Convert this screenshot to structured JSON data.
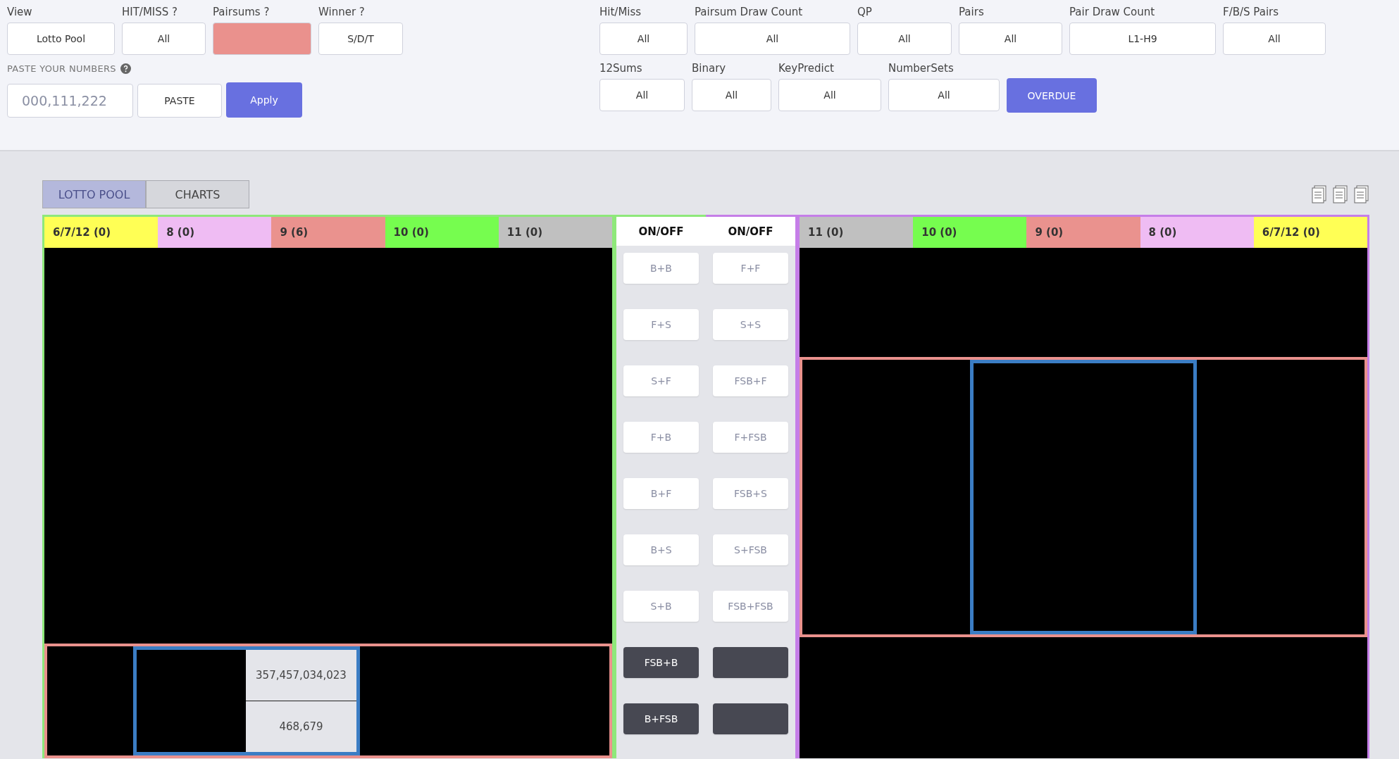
{
  "left_filters": [
    {
      "label": "View",
      "value": "Lotto Pool",
      "highlighted": false
    },
    {
      "label": "HIT/MISS ?",
      "value": "All",
      "highlighted": false
    },
    {
      "label": "Pairsums ?",
      "highlighted": true
    },
    {
      "label": "Winner ?",
      "value": "S/D/T",
      "highlighted": false
    }
  ],
  "paste": {
    "label": "PASTE YOUR NUMBERS",
    "placeholder": "000,111,222",
    "paste_button": "PASTE",
    "apply_button": "Apply"
  },
  "right_filters": [
    [
      {
        "label": "Hit/Miss",
        "value": "All"
      },
      {
        "label": "Pairsum Draw Count",
        "value": "All"
      },
      {
        "label": "QP",
        "value": "All"
      },
      {
        "label": "Pairs",
        "value": "All"
      },
      {
        "label": "Pair Draw Count",
        "value": "L1-H9"
      },
      {
        "label": "F/B/S Pairs",
        "value": "All"
      }
    ],
    [
      {
        "label": "12Sums",
        "value": "All"
      },
      {
        "label": "Binary",
        "value": "All"
      },
      {
        "label": "KeyPredict",
        "value": "All"
      },
      {
        "label": "NumberSets",
        "value": "All"
      }
    ]
  ],
  "overdue_button": "OVERDUE",
  "tabs": [
    {
      "label": "LOTTO POOL",
      "selected": true
    },
    {
      "label": "CHARTS",
      "selected": false
    }
  ],
  "left_panel": {
    "headers": [
      {
        "label": "6/7/12 (0)",
        "color": "#ffff55"
      },
      {
        "label": "8 (0)",
        "color": "#efbcf3"
      },
      {
        "label": "9 (6)",
        "color": "#ea928e"
      },
      {
        "label": "10 (0)",
        "color": "#76fd4f"
      },
      {
        "label": "11 (0)",
        "color": "#c0c0c0"
      }
    ],
    "cells": [
      "357,457,034,023",
      "468,679"
    ]
  },
  "center": {
    "columns": [
      {
        "header": "ON/OFF",
        "buttons": [
          {
            "label": "B+B",
            "kind": "light"
          },
          {
            "label": "F+S",
            "kind": "light"
          },
          {
            "label": "S+F",
            "kind": "light"
          },
          {
            "label": "F+B",
            "kind": "light"
          },
          {
            "label": "B+F",
            "kind": "light"
          },
          {
            "label": "B+S",
            "kind": "light"
          },
          {
            "label": "S+B",
            "kind": "light"
          },
          {
            "label": "FSB+B",
            "kind": "dark"
          },
          {
            "label": "B+FSB",
            "kind": "dark"
          }
        ]
      },
      {
        "header": "ON/OFF",
        "buttons": [
          {
            "label": "F+F",
            "kind": "light"
          },
          {
            "label": "S+S",
            "kind": "light"
          },
          {
            "label": "FSB+F",
            "kind": "light"
          },
          {
            "label": "F+FSB",
            "kind": "light"
          },
          {
            "label": "FSB+S",
            "kind": "light"
          },
          {
            "label": "S+FSB",
            "kind": "light"
          },
          {
            "label": "FSB+FSB",
            "kind": "light"
          },
          {
            "kind": "dark"
          },
          {
            "kind": "dark"
          }
        ]
      }
    ]
  },
  "right_panel": {
    "headers": [
      {
        "label": "11 (0)",
        "color": "#c0c0c0"
      },
      {
        "label": "10 (0)",
        "color": "#76fd4f"
      },
      {
        "label": "9 (0)",
        "color": "#ea928e"
      },
      {
        "label": "8 (0)",
        "color": "#efbcf3"
      },
      {
        "label": "6/7/12 (0)",
        "color": "#ffff55"
      }
    ]
  }
}
